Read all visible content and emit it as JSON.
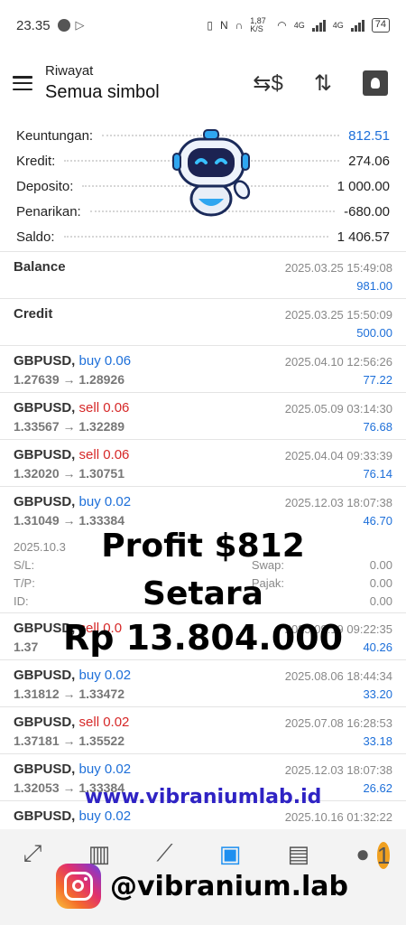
{
  "status_bar": {
    "time": "23.35",
    "net_speed": "1,87 K/S",
    "net1": "4G",
    "net2": "4G",
    "battery": "74"
  },
  "header": {
    "subtitle": "Riwayat",
    "title": "Semua simbol",
    "icons": [
      "currency-exchange-icon",
      "sort-icon",
      "calendar-icon"
    ]
  },
  "summary": [
    {
      "label": "Keuntungan:",
      "value": "812.51",
      "color": "#1d6fd9"
    },
    {
      "label": "Kredit:",
      "value": "274.06"
    },
    {
      "label": "Deposito:",
      "value": "1 000.00"
    },
    {
      "label": "Penarikan:",
      "value": "-680.00"
    },
    {
      "label": "Saldo:",
      "value": "1 406.57"
    }
  ],
  "entries": [
    {
      "symbol": "Balance",
      "date": "2025.03.25 15:49:08",
      "profit": "981.00"
    },
    {
      "symbol": "Credit",
      "date": "2025.03.25 15:50:09",
      "profit": "500.00"
    },
    {
      "symbol": "GBPUSD,",
      "side": "buy",
      "volume": "0.06",
      "prices": "1.27639 → 1.28926",
      "date": "2025.04.10 12:56:26",
      "profit": "77.22"
    },
    {
      "symbol": "GBPUSD,",
      "side": "sell",
      "volume": "0.06",
      "prices": "1.33567 → 1.32289",
      "date": "2025.05.09 03:14:30",
      "profit": "76.68"
    },
    {
      "symbol": "GBPUSD,",
      "side": "sell",
      "volume": "0.06",
      "prices": "1.32020 → 1.30751",
      "date": "2025.04.04 09:33:39",
      "profit": "76.14"
    },
    {
      "symbol": "GBPUSD,",
      "side": "buy",
      "volume": "0.02",
      "prices": "1.31049 → 1.33384",
      "date": "2025.12.03 18:07:38",
      "profit": "46.70"
    }
  ],
  "detail": {
    "open": "2025.10.3",
    "rows": [
      {
        "left": "S/L:",
        "mid": "Swap:",
        "right": "0.00"
      },
      {
        "left": "T/P:",
        "mid": "Pajak:",
        "right": "0.00"
      },
      {
        "left": "ID:",
        "mid": "",
        "right": "0.00"
      }
    ]
  },
  "entries2": [
    {
      "symbol": "GBPUSD,",
      "side": "sell",
      "volume": "0.0",
      "prices": "1.37",
      "date": "2025.09.19 09:22:35",
      "profit": "40.26"
    },
    {
      "symbol": "GBPUSD,",
      "side": "buy",
      "volume": "0.02",
      "prices": "1.31812 → 1.33472",
      "date": "2025.08.06 18:44:34",
      "profit": "33.20"
    },
    {
      "symbol": "GBPUSD,",
      "side": "sell",
      "volume": "0.02",
      "prices": "1.37181 → 1.35522",
      "date": "2025.07.08 16:28:53",
      "profit": "33.18"
    },
    {
      "symbol": "GBPUSD,",
      "side": "buy",
      "volume": "0.02",
      "prices": "1.32053 → 1.33384",
      "date": "2025.12.03 18:07:38",
      "profit": "26.62"
    },
    {
      "symbol": "GBPUSD,",
      "side": "buy",
      "volume": "0.02",
      "prices": "",
      "date": "2025.10.16 01:32:22",
      "profit": ""
    }
  ],
  "promo": {
    "line1": "Profit $812",
    "line2": "Setara",
    "line3": "Rp 13.804.000",
    "url": "www.vibraniumlab.id",
    "instagram": "@vibranium.lab"
  },
  "bottom_nav": {
    "icons": [
      "trade-icon",
      "chart-icon",
      "trend-icon",
      "history-icon",
      "news-icon",
      "chat-icon"
    ],
    "chat_badge": "1"
  }
}
